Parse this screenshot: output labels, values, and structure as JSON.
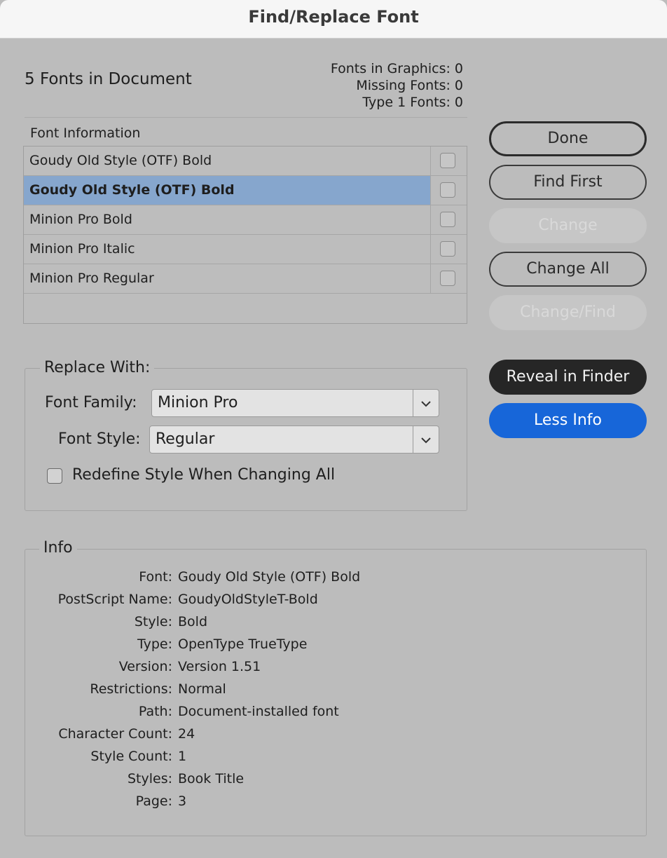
{
  "window": {
    "title": "Find/Replace Font"
  },
  "summary": {
    "fonts_in_document": "5 Fonts in Document",
    "fonts_in_graphics": "Fonts in Graphics: 0",
    "missing_fonts": "Missing Fonts: 0",
    "type1_fonts": "Type 1 Fonts: 0"
  },
  "font_list": {
    "header": "Font Information",
    "items": [
      {
        "name": "Goudy Old Style (OTF) Bold",
        "selected": false
      },
      {
        "name": "Goudy Old Style (OTF) Bold",
        "selected": true
      },
      {
        "name": "Minion Pro Bold",
        "selected": false
      },
      {
        "name": "Minion Pro Italic",
        "selected": false
      },
      {
        "name": "Minion Pro Regular",
        "selected": false
      }
    ]
  },
  "buttons": {
    "done": "Done",
    "find_first": "Find First",
    "change": "Change",
    "change_all": "Change All",
    "change_find": "Change/Find",
    "reveal_in_finder": "Reveal in Finder",
    "less_info": "Less Info"
  },
  "replace_with": {
    "label": "Replace With:",
    "font_family_label": "Font Family:",
    "font_family_value": "Minion Pro",
    "font_style_label": "Font Style:",
    "font_style_value": "Regular",
    "redefine_label": "Redefine Style When Changing All",
    "redefine_checked": false
  },
  "info": {
    "label": "Info",
    "rows": [
      {
        "key": "Font:",
        "value": "Goudy Old Style (OTF) Bold"
      },
      {
        "key": "PostScript Name:",
        "value": "GoudyOldStyleT-Bold"
      },
      {
        "key": "Style:",
        "value": "Bold"
      },
      {
        "key": "Type:",
        "value": "OpenType TrueType"
      },
      {
        "key": "Version:",
        "value": "Version 1.51"
      },
      {
        "key": "Restrictions:",
        "value": "Normal"
      },
      {
        "key": "Path:",
        "value": "Document-installed font"
      },
      {
        "key": "Character Count:",
        "value": "24"
      },
      {
        "key": "Style Count:",
        "value": "1"
      },
      {
        "key": "Styles:",
        "value": "Book Title"
      },
      {
        "key": "Page:",
        "value": "3"
      }
    ]
  },
  "colors": {
    "selection": "#86a6cd",
    "primary_blue": "#1766d9",
    "dark_button": "#262626",
    "dialog_background": "#bcbcbc"
  }
}
